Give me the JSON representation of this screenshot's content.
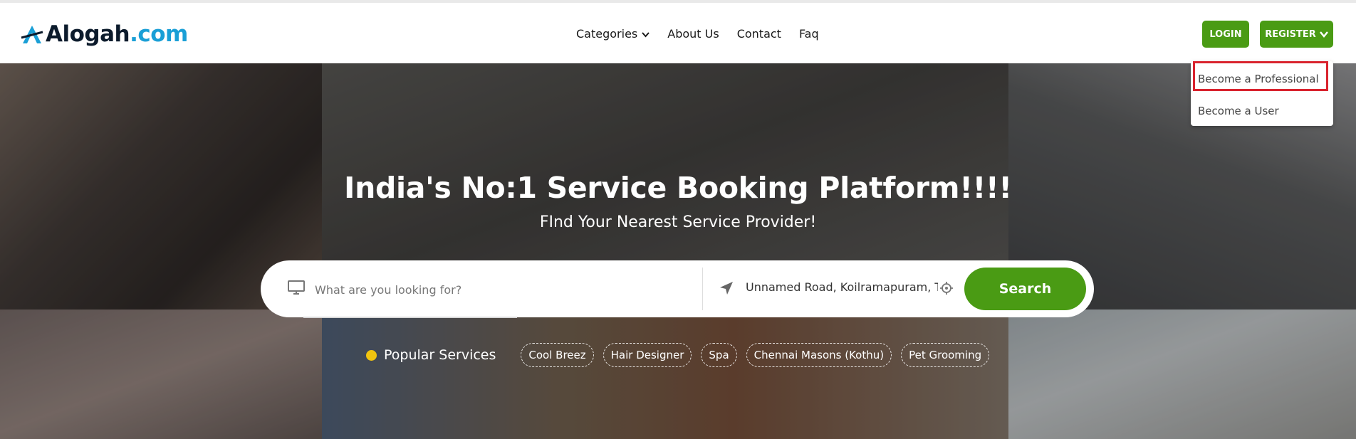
{
  "logo": {
    "text_main": "Alogah",
    "text_suffix": ".com",
    "icon": "logo-icon"
  },
  "nav": {
    "items": [
      {
        "label": "Categories",
        "has_dropdown": true
      },
      {
        "label": "About Us"
      },
      {
        "label": "Contact"
      },
      {
        "label": "Faq"
      }
    ]
  },
  "auth": {
    "login_label": "LOGIN",
    "register_label": "REGISTER"
  },
  "register_menu": {
    "items": [
      {
        "label": "Become a Professional",
        "highlighted": true
      },
      {
        "label": "Become a User"
      }
    ]
  },
  "hero": {
    "title": "India's No:1 Service Booking Platform!!!!",
    "subtitle": "FInd Your Nearest Service Provider!"
  },
  "search": {
    "placeholder": "What are you looking for?",
    "location": "Unnamed Road, Koilramapuram, Ta",
    "button_label": "Search"
  },
  "popular": {
    "label": "Popular Services",
    "chips": [
      "Cool Breez",
      "Hair Designer",
      "Spa",
      "Chennai Masons (Kothu)",
      "Pet Grooming"
    ]
  },
  "colors": {
    "brand_green": "#4a9b14",
    "logo_blue": "#1a9fd6",
    "highlight_red": "#d9232e",
    "popular_dot": "#f1c40f"
  }
}
